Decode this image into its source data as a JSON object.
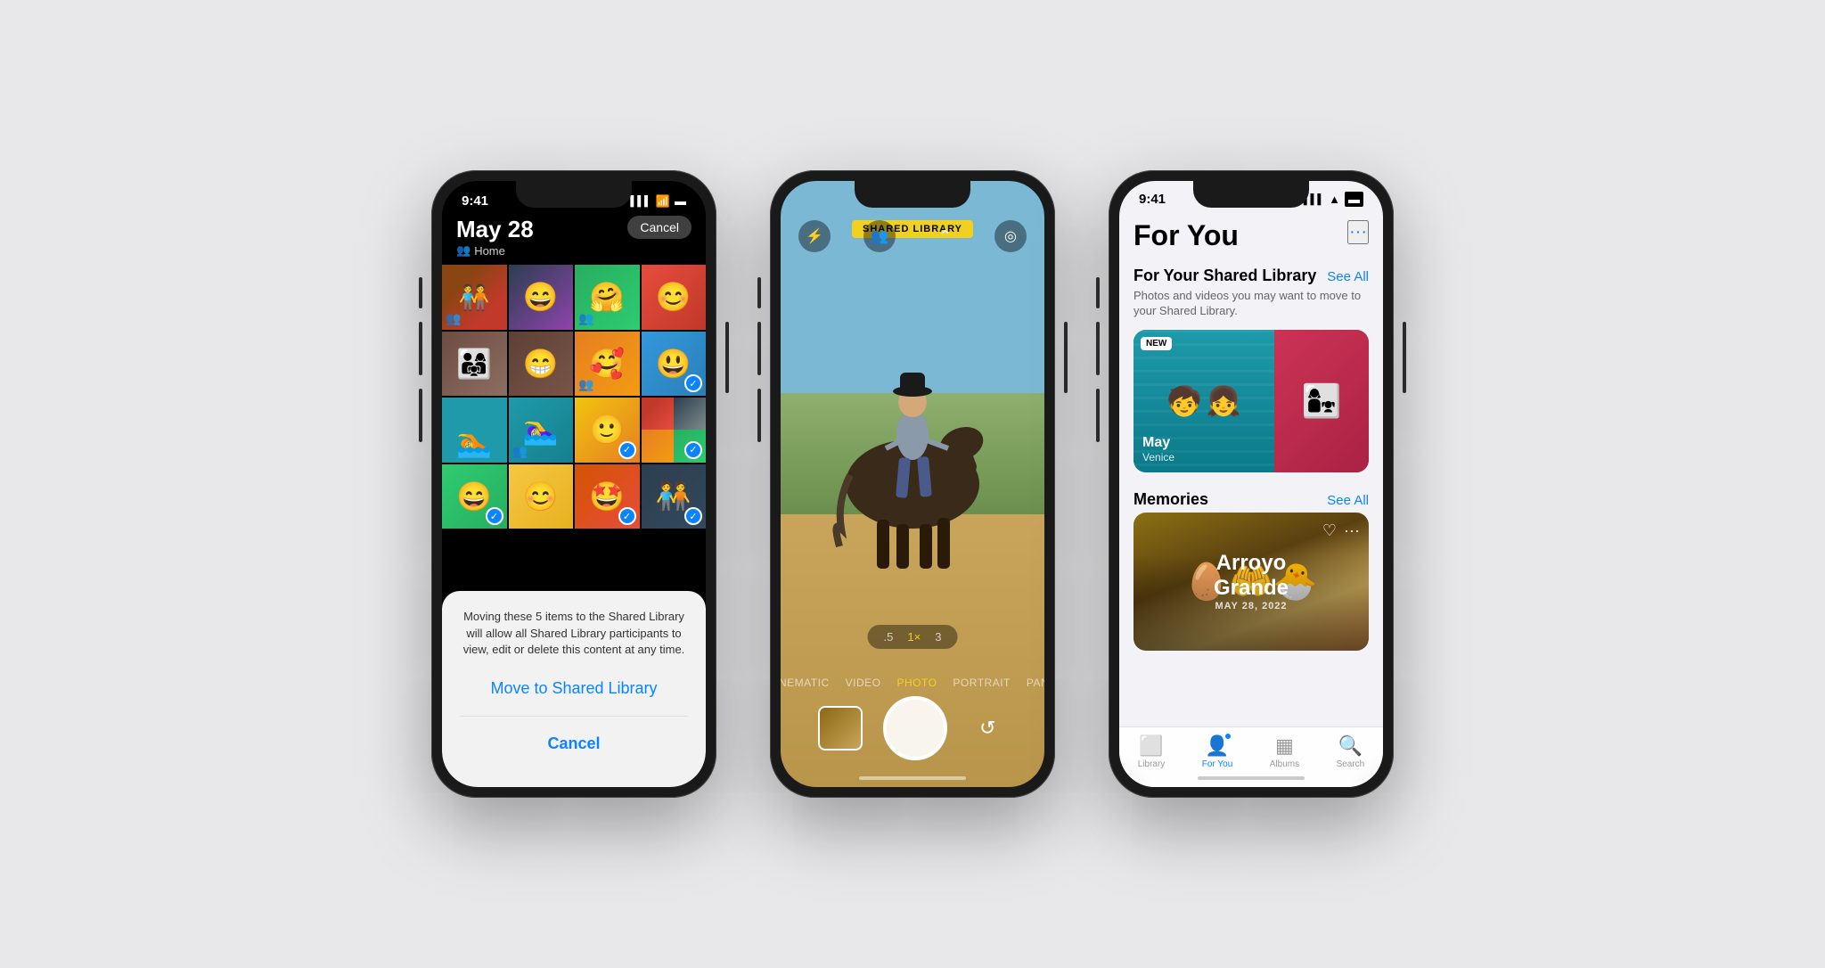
{
  "scene": {
    "bg_color": "#e8e8ea"
  },
  "phone1": {
    "status": {
      "time": "9:41",
      "signal": "●●●●",
      "wifi": "wifi",
      "battery": "battery"
    },
    "header": {
      "date": "May 28",
      "location": "Home",
      "cancel_label": "Cancel"
    },
    "grid_photos": [
      {
        "id": 1,
        "color_class": "pc1",
        "has_check": false,
        "has_shared": true
      },
      {
        "id": 2,
        "color_class": "pc2",
        "has_check": false,
        "has_shared": false
      },
      {
        "id": 3,
        "color_class": "pc3",
        "has_check": false,
        "has_shared": true
      },
      {
        "id": 4,
        "color_class": "pc4",
        "has_check": false,
        "has_shared": false
      },
      {
        "id": 5,
        "color_class": "pc5",
        "has_check": false,
        "has_shared": false
      },
      {
        "id": 6,
        "color_class": "pc6",
        "has_check": false,
        "has_shared": false
      },
      {
        "id": 7,
        "color_class": "pc7",
        "has_check": false,
        "has_shared": true
      },
      {
        "id": 8,
        "color_class": "pc8",
        "has_check": true,
        "has_shared": false
      },
      {
        "id": 9,
        "color_class": "pc9",
        "has_check": false,
        "has_shared": false
      },
      {
        "id": 10,
        "color_class": "pc10",
        "has_check": false,
        "has_shared": true
      },
      {
        "id": 11,
        "color_class": "pc11",
        "has_check": false,
        "has_shared": false
      },
      {
        "id": 12,
        "color_class": "pc12",
        "has_check": true,
        "has_shared": false
      },
      {
        "id": 13,
        "color_class": "pc13",
        "has_check": true,
        "has_shared": false
      },
      {
        "id": 14,
        "color_class": "pc14",
        "has_check": false,
        "has_shared": false
      },
      {
        "id": 15,
        "color_class": "pc15",
        "has_check": true,
        "has_shared": false
      },
      {
        "id": 16,
        "color_class": "pc16",
        "has_check": true,
        "has_shared": false
      }
    ],
    "popup": {
      "description": "Moving these 5 items to the Shared Library will allow all Shared Library participants to view, edit or delete this content at any time.",
      "move_label": "Move to Shared Library",
      "cancel_label": "Cancel"
    }
  },
  "phone2": {
    "status": {
      "time": "",
      "signal": "",
      "wifi": "",
      "battery": ""
    },
    "shared_badge": "SHARED LIBRARY",
    "top_controls": {
      "flash_icon": "⚡",
      "people_icon": "👥",
      "settings_icon": "◎",
      "chevron_up": "⌃"
    },
    "zoom_levels": [
      {
        "label": ".5",
        "active": false
      },
      {
        "label": "1×",
        "active": true
      },
      {
        "label": "3",
        "active": false
      }
    ],
    "modes": [
      {
        "label": "CINEMATIC",
        "active": false
      },
      {
        "label": "VIDEO",
        "active": false
      },
      {
        "label": "PHOTO",
        "active": true
      },
      {
        "label": "PORTRAIT",
        "active": false
      },
      {
        "label": "PANO",
        "active": false
      }
    ]
  },
  "phone3": {
    "status": {
      "time": "9:41",
      "signal": "●●●●",
      "wifi": "wifi",
      "battery": "battery"
    },
    "more_icon": "···",
    "title": "For You",
    "shared_library_section": {
      "heading": "For Your Shared Library",
      "see_all": "See All",
      "description": "Photos and videos you may want to move to your Shared Library.",
      "card": {
        "new_badge": "NEW",
        "label_main": "May",
        "label_sub": "Venice"
      }
    },
    "memories_section": {
      "heading": "Memories",
      "see_all": "See All",
      "card": {
        "title": "Arroyo\nGrande",
        "date": "MAY 28, 2022"
      }
    },
    "tabs": [
      {
        "label": "Library",
        "icon": "🖼",
        "active": false
      },
      {
        "label": "For You",
        "icon": "👤",
        "active": true,
        "has_badge": true
      },
      {
        "label": "Albums",
        "icon": "▦",
        "active": false
      },
      {
        "label": "Search",
        "icon": "🔍",
        "active": false
      }
    ]
  }
}
